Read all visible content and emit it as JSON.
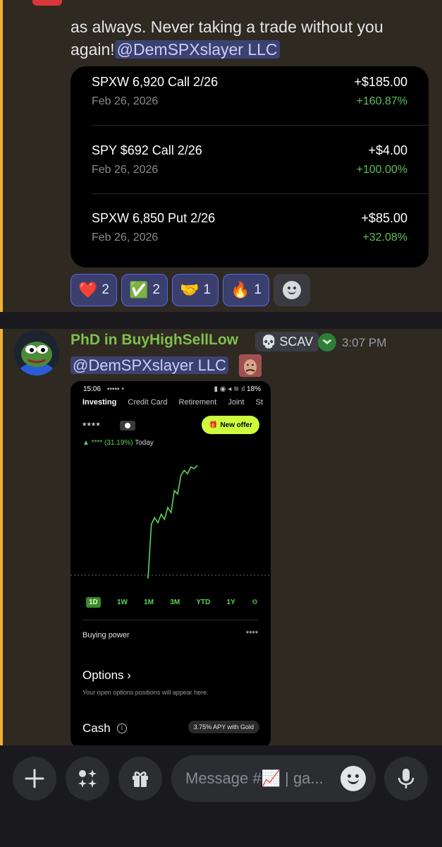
{
  "message1": {
    "text": "as always. Never taking a trade without you again!",
    "mention": "@DemSPXslayer LLC",
    "trades": [
      {
        "name": "SPXW 6,920 Call 2/26",
        "date": "Feb 26, 2026",
        "amount": "+$185.00",
        "percent": "+160.87%"
      },
      {
        "name": "SPY $692 Call 2/26",
        "date": "Feb 26, 2026",
        "amount": "+$4.00",
        "percent": "+100.00%"
      },
      {
        "name": "SPXW 6,850 Put 2/26",
        "date": "Feb 26, 2026",
        "amount": "+$85.00",
        "percent": "+32.08%"
      }
    ],
    "reactions": [
      {
        "emoji": "❤️",
        "count": "2"
      },
      {
        "emoji": "✅",
        "count": "2"
      },
      {
        "emoji": "🤝",
        "count": "1"
      },
      {
        "emoji": "🔥",
        "count": "1"
      }
    ]
  },
  "message2": {
    "username": "PhD in BuyHighSellLow",
    "tag": "SCAV",
    "tag_icon": "skull-icon",
    "time": "3:07 PM",
    "mention": "@DemSPXslayer LLC",
    "screenshot": {
      "status_time": "15:06",
      "status_right": "18%",
      "tabs": [
        "Investing",
        "Credit Card",
        "Retirement",
        "Joint",
        "St"
      ],
      "balance_mask": "****",
      "offer_label": "New offer",
      "change_arrow": "▲",
      "change_text": "**** (31.19%)",
      "change_period": "Today",
      "ranges": [
        "1D",
        "1W",
        "1M",
        "3M",
        "YTD",
        "1Y"
      ],
      "buying_power_label": "Buying power",
      "buying_power_value": "****",
      "options_title": "Options ›",
      "options_sub": "Your open options positions will appear here.",
      "cash_title": "Cash",
      "apy_label": "3.75% APY with Gold"
    }
  },
  "composer": {
    "placeholder": "Message #📈 | ga...",
    "accent": "#5865f2"
  },
  "chart_data": {
    "type": "line",
    "title": "",
    "xlabel": "",
    "ylabel": "",
    "y": [
      0,
      0,
      0,
      0,
      -4,
      60,
      68,
      62,
      72,
      66,
      80,
      74,
      100,
      96,
      118,
      124,
      120,
      128,
      126,
      130
    ],
    "baseline": 0,
    "color": "#5fd35a"
  }
}
